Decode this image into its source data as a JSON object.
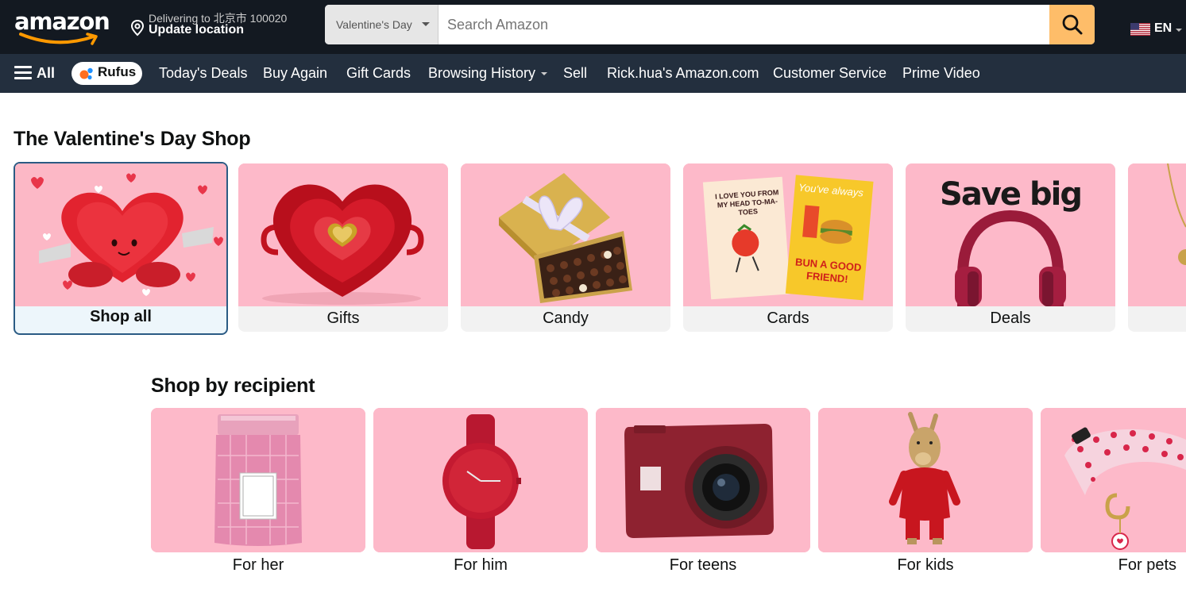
{
  "brand": {
    "logo_text": "amazon"
  },
  "header": {
    "delivery_line1": "Delivering to 北京市 100020",
    "delivery_line2": "Update location",
    "search_department": "Valentine's Day",
    "search_placeholder": "Search Amazon",
    "language": "EN",
    "icons": {
      "location": "location-pin-icon",
      "search": "search-icon",
      "flag": "us-flag-icon"
    }
  },
  "subnav": {
    "all_label": "All",
    "rufus_label": "Rufus",
    "links": [
      "Today's Deals",
      "Buy Again",
      "Gift Cards",
      "Browsing History",
      "Sell",
      "Rick.hua's Amazon.com",
      "Customer Service",
      "Prime Video"
    ]
  },
  "valentines": {
    "title": "The Valentine's Day Shop",
    "cards": [
      {
        "label": "Shop all",
        "selected": true
      },
      {
        "label": "Gifts"
      },
      {
        "label": "Candy"
      },
      {
        "label": "Cards"
      },
      {
        "label": "Deals",
        "image_text": "Save big"
      }
    ],
    "card_image_texts": {
      "cards_left": "I LOVE YOU FROM MY HEAD TO-MA-TOES",
      "cards_right_top": "You've always",
      "cards_right_bottom": "BUN A GOOD FRIEND!"
    }
  },
  "recipients": {
    "title": "Shop by recipient",
    "cards": [
      {
        "label": "For her"
      },
      {
        "label": "For him"
      },
      {
        "label": "For teens"
      },
      {
        "label": "For kids"
      },
      {
        "label": "For pets"
      }
    ]
  },
  "colors": {
    "nav_dark": "#131921",
    "nav_sub": "#232f3e",
    "search_button": "#febd69",
    "tile_pink": "#fdb9c9",
    "selected_border": "#2a5b84"
  }
}
